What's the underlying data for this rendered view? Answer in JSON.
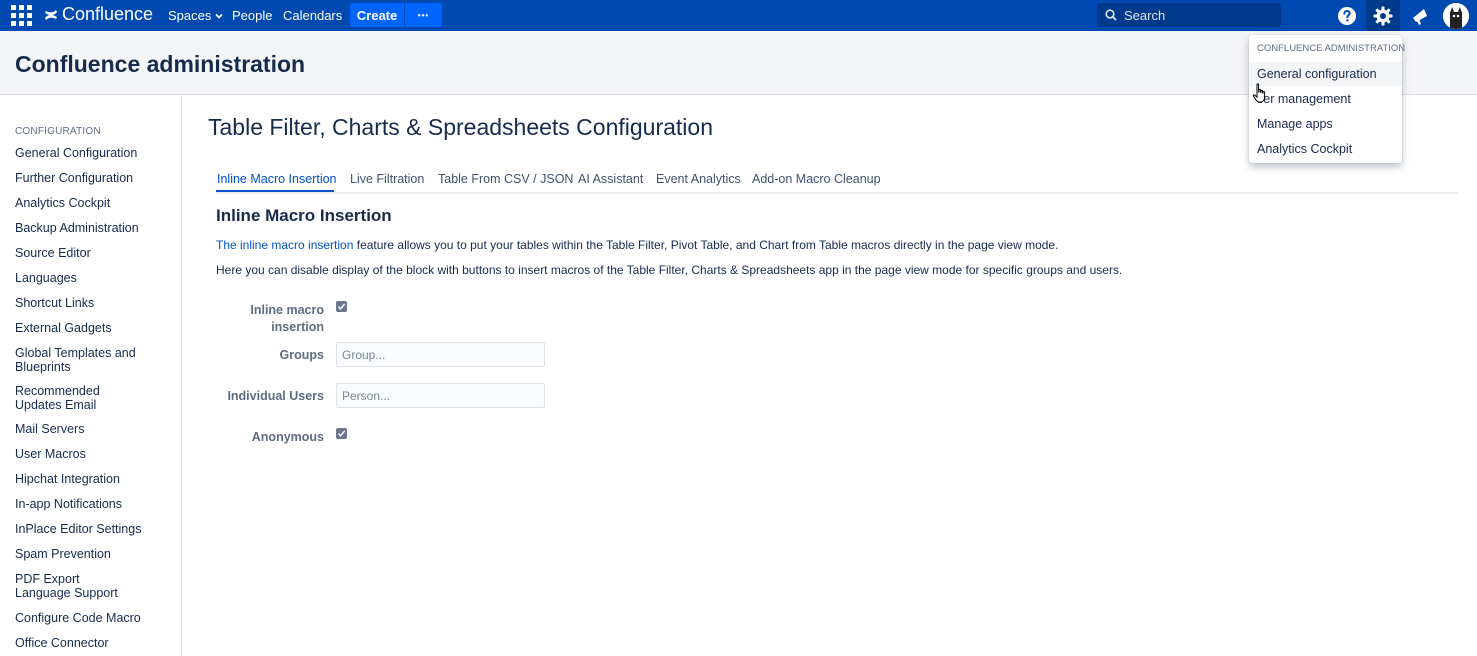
{
  "topnav": {
    "brand": "Confluence",
    "links": {
      "spaces": "Spaces",
      "people": "People",
      "calendars": "Calendars"
    },
    "create_label": "Create",
    "more_label": "•••",
    "search_placeholder": "Search",
    "colors": {
      "bar": "#0049b0",
      "create": "#0065ff"
    }
  },
  "header": {
    "title": "Confluence administration"
  },
  "sidebar": {
    "heading": "CONFIGURATION",
    "items": [
      "General Configuration",
      "Further Configuration",
      "Analytics Cockpit",
      "Backup Administration",
      "Source Editor",
      "Languages",
      "Shortcut Links",
      "External Gadgets",
      "Global Templates and Blueprints",
      "Recommended Updates Email",
      "Mail Servers",
      "User Macros",
      "Hipchat Integration",
      "In-app Notifications",
      "InPlace Editor Settings",
      "Spam Prevention",
      "PDF Export Language Support",
      "Configure Code Macro",
      "Office Connector"
    ]
  },
  "main": {
    "title": "Table Filter, Charts & Spreadsheets Configuration",
    "tabs": [
      "Inline Macro Insertion",
      "Live Filtration",
      "Table From CSV / JSON",
      "AI Assistant",
      "Event Analytics",
      "Add-on Macro Cleanup"
    ],
    "active_tab": "Inline Macro Insertion",
    "section_title": "Inline Macro Insertion",
    "para1_link": "The inline macro insertion",
    "para1_rest": " feature allows you to put your tables within the Table Filter, Pivot Table, and Chart from Table macros directly in the page view mode.",
    "para2": "Here you can disable display of the block with buttons to insert macros of the Table Filter, Charts & Spreadsheets app in the page view mode for specific groups and users.",
    "form": {
      "inline_label": "Inline macro insertion",
      "inline_checked": true,
      "groups_label": "Groups",
      "groups_placeholder": "Group...",
      "users_label": "Individual Users",
      "users_placeholder": "Person...",
      "anonymous_label": "Anonymous",
      "anonymous_checked": true
    }
  },
  "dropdown": {
    "heading": "CONFLUENCE ADMINISTRATION",
    "items": [
      "General configuration",
      "ser management",
      "Manage apps",
      "Analytics Cockpit"
    ]
  }
}
